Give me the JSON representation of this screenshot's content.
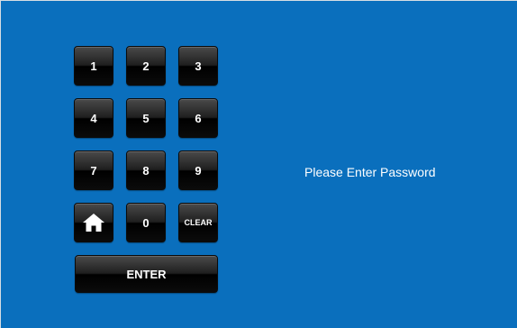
{
  "keypad": {
    "keys": {
      "k1": "1",
      "k2": "2",
      "k3": "3",
      "k4": "4",
      "k5": "5",
      "k6": "6",
      "k7": "7",
      "k8": "8",
      "k9": "9",
      "k0": "0",
      "clear": "CLEAR",
      "home_icon": "home-icon"
    },
    "enter_label": "ENTER"
  },
  "prompt_text": "Please Enter Password",
  "colors": {
    "background": "#0a6fbd",
    "key_face": "#111111",
    "key_text": "#ffffff"
  }
}
